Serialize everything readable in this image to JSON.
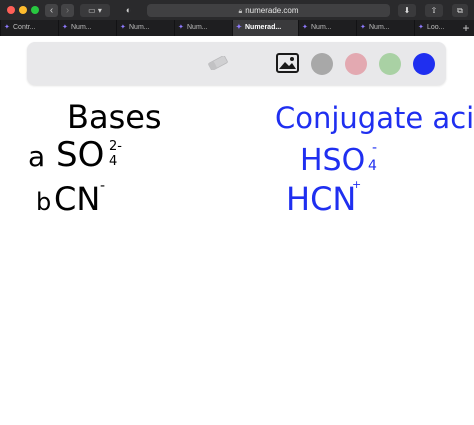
{
  "browser": {
    "url": "numerade.com",
    "tabs": [
      {
        "label": "Contr..."
      },
      {
        "label": "Num..."
      },
      {
        "label": "Num..."
      },
      {
        "label": "Numerad..."
      },
      {
        "label": "Num..."
      },
      {
        "label": "Num..."
      },
      {
        "label": "Loo..."
      }
    ],
    "icons": [
      "back-icon",
      "forward-icon",
      "sidebar-icon",
      "shield-icon",
      "lock-icon",
      "download-icon",
      "share-icon",
      "tabs-icon",
      "plus-icon"
    ]
  },
  "whiteboard": {
    "tools": [
      "eraser-icon",
      "image-icon"
    ],
    "colors": [
      "#a8a8a8",
      "#e3a9b1",
      "#a9d1a4",
      "#1f2ff0"
    ],
    "left_column": {
      "heading": "Bases",
      "items": [
        {
          "letter": "a",
          "formula": "SO",
          "sub": "4",
          "sup": "2-"
        },
        {
          "letter": "b",
          "formula": "CN",
          "sup": "-"
        }
      ],
      "ink_color": "#000000"
    },
    "right_column": {
      "heading": "Conjugate acids",
      "items": [
        {
          "formula": "HSO",
          "sub": "4",
          "sup": "-"
        },
        {
          "formula": "HCN"
        }
      ],
      "ink_color": "#1f2ff0"
    }
  }
}
